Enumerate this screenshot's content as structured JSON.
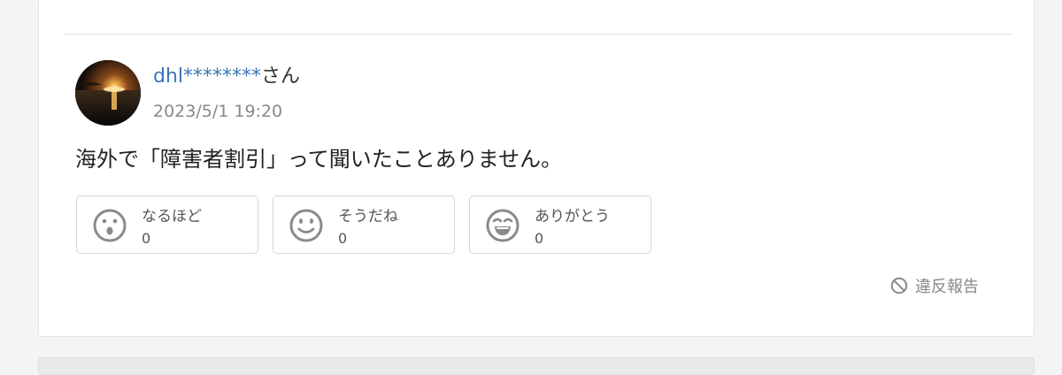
{
  "post": {
    "username": "dhl********",
    "suffix": "さん",
    "timestamp": "2023/5/1 19:20",
    "comment": "海外で「障害者割引」って聞いたことありません。"
  },
  "reactions": [
    {
      "label": "なるほど",
      "count": "0",
      "icon": "surprised-face-icon"
    },
    {
      "label": "そうだね",
      "count": "0",
      "icon": "smile-face-icon"
    },
    {
      "label": "ありがとう",
      "count": "0",
      "icon": "grin-face-icon"
    }
  ],
  "report": {
    "label": "違反報告",
    "icon": "prohibited-icon"
  },
  "colors": {
    "username": "#3a74b8",
    "icon_gray": "#8a8a8a",
    "border": "#d6d6d6"
  }
}
